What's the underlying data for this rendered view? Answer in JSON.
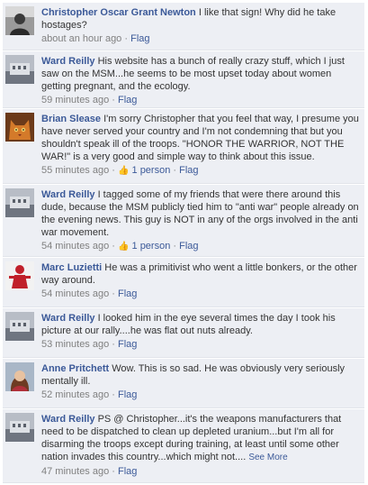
{
  "comments": [
    {
      "author": "Christopher Oscar Grant Newton",
      "text": "I like that sign! Why did he take hostages?",
      "time": "about an hour ago",
      "flag": "Flag",
      "avatar": "portrait-bw"
    },
    {
      "author": "Ward Reilly",
      "text": "His website has a bunch of really crazy stuff, which I just saw on the MSM...he seems to be most upset today about women getting pregnant, and the ecology.",
      "time": "59 minutes ago",
      "flag": "Flag",
      "avatar": "building-photo"
    },
    {
      "author": "Brian Slease",
      "text": "I'm sorry Christopher that you feel that way, I presume you have never served your country and I'm not condemning that but you shouldn't speak ill of the troops. \"HONOR THE WARRIOR, NOT THE WAR!\" is a very good and simple way to think about this issue.",
      "time": "55 minutes ago",
      "likes": "1 person",
      "flag": "Flag",
      "avatar": "cat-photo"
    },
    {
      "author": "Ward Reilly",
      "text": "I tagged some of my friends that were there around this dude, because the MSM publicly tied him to \"anti war\" people already on the evening news. This guy is NOT in any of the orgs involved in the anti war movement.",
      "time": "54 minutes ago",
      "likes": "1 person",
      "flag": "Flag",
      "avatar": "building-photo"
    },
    {
      "author": "Marc Luzietti",
      "text": "He was a primitivist who went a little bonkers, or the other way around.",
      "time": "54 minutes ago",
      "flag": "Flag",
      "avatar": "red-figure"
    },
    {
      "author": "Ward Reilly",
      "text": "I looked him in the eye several times the day I took his picture at our rally....he was flat out nuts already.",
      "time": "53 minutes ago",
      "flag": "Flag",
      "avatar": "building-photo"
    },
    {
      "author": "Anne Pritchett",
      "text": "Wow. This is so sad. He was obviously very seriously mentally ill.",
      "time": "52 minutes ago",
      "flag": "Flag",
      "avatar": "woman-portrait"
    },
    {
      "author": "Ward Reilly",
      "text": "PS @ Christopher...it's the weapons manufacturers that need to be dispatched to clean up depleted uranium...but I'm all for disarming the troops except during training, at least until some other nation invades this country...which might not....",
      "see_more": "See More",
      "time": "47 minutes ago",
      "flag": "Flag",
      "avatar": "building-photo"
    }
  ],
  "separator": " · ",
  "colors": {
    "comment_bg": "#edeff4",
    "link": "#3b5998",
    "meta": "#808080",
    "text": "#333333"
  }
}
